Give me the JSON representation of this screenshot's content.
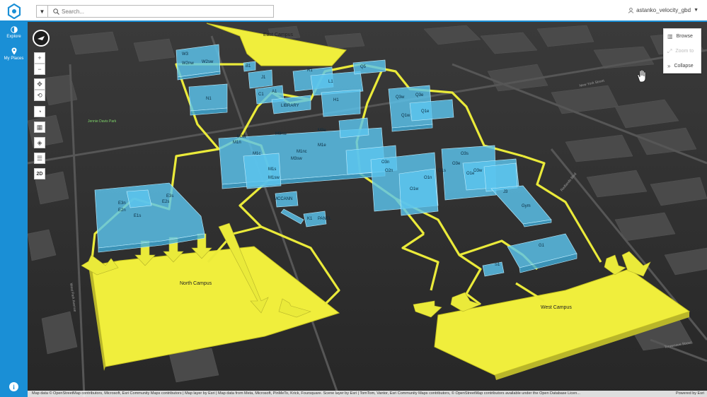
{
  "header": {
    "search_placeholder": "Search...",
    "username": "astanko_velocity_gbd"
  },
  "leftnav": {
    "items": [
      {
        "label": "Explore",
        "icon": "explore-icon"
      },
      {
        "label": "My Places",
        "icon": "places-icon"
      }
    ],
    "info_label": "i"
  },
  "map_tools": {
    "zoom_in": "+",
    "zoom_out": "−",
    "mode_2d": "2D"
  },
  "side_panel": {
    "browse": "Browse",
    "zoom_to": "Zoom to",
    "collapse": "Collapse"
  },
  "map": {
    "campus_labels": {
      "east": "East Campus",
      "north": "North Campus",
      "west": "West Campus"
    },
    "park_label": "Jennie Davis Park",
    "street_labels": [
      "New York Street",
      "Tennessee Street",
      "West Park Avenue",
      "Redlands Blvd"
    ],
    "building_labels": [
      "W3",
      "W2nw",
      "W2sw",
      "N1",
      "B1",
      "J1",
      "C1",
      "A1",
      "R1",
      "L1",
      "LIBRARY",
      "H1",
      "Q5",
      "Q3e",
      "Q3w",
      "Q1e",
      "Q1w",
      "G1",
      "M3e",
      "M1n",
      "M3w",
      "M1c",
      "M3sw",
      "M3nw",
      "M1nc",
      "M1s",
      "M1e",
      "M1sw",
      "O3n",
      "O3s",
      "O3e",
      "O3w",
      "O1s",
      "O1e",
      "O1w",
      "O1n",
      "O2n",
      "J3",
      "Gym",
      "S1",
      "E3n",
      "E2n",
      "E3s",
      "E2s",
      "E1s",
      "MCCANN",
      "K1",
      "PANEL"
    ]
  },
  "attribution": {
    "left": "Map data © OpenStreetMap contributors, Microsoft, Esri Community Maps contributors | Map layer by Esri | Map data from Meta, Microsoft, PinMeTo, Krick, Foursquare. Scene layer by Esri | TomTom, Vantor, Esri Community Maps contributors, © OpenStreetMap contributors available under the Open Database Licen...",
    "right": "Powered by Esri"
  }
}
